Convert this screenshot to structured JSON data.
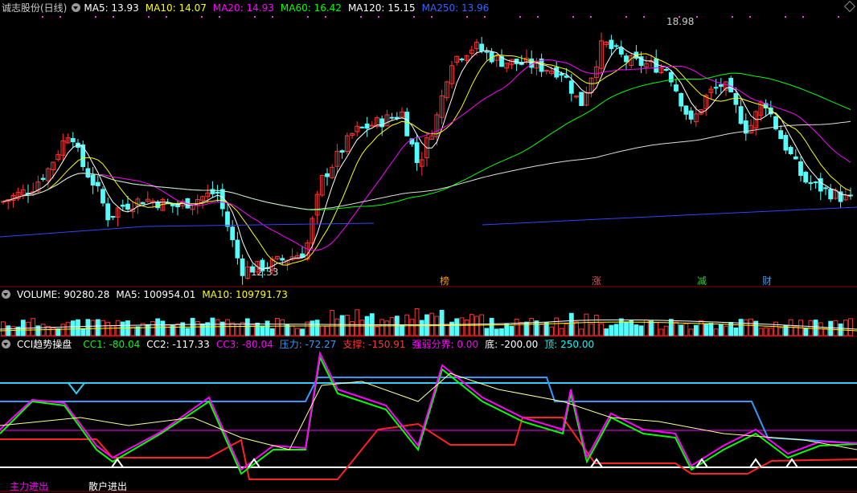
{
  "main": {
    "stock_name": "诚志股份(日线)",
    "ma": [
      {
        "label": "MA5: 13.93",
        "color": "#ffffff"
      },
      {
        "label": "MA10: 14.07",
        "color": "#ffff00"
      },
      {
        "label": "MA20: 14.93",
        "color": "#ff00ff"
      },
      {
        "label": "MA60: 16.42",
        "color": "#00ff00"
      },
      {
        "label": "MA120: 15.15",
        "color": "#ffffff"
      },
      {
        "label": "MA250: 13.96",
        "color": "#3366ff"
      }
    ],
    "high_label": "18.98",
    "low_label": "12.33",
    "markers": [
      {
        "text": "榜",
        "color": "#ff9900"
      },
      {
        "text": "涨",
        "color": "#ff4444"
      },
      {
        "text": "减",
        "color": "#33cc33"
      },
      {
        "text": "财",
        "color": "#3399ff"
      }
    ]
  },
  "volume": {
    "label": "VOLUME: 90280.28",
    "ma5": "MA5: 100954.01",
    "ma10": "MA10: 109791.73"
  },
  "cci": {
    "title": "CCI趋势操盘",
    "items": [
      {
        "label": "CC1: -80.04",
        "color": "#00ff00"
      },
      {
        "label": "CC2: -117.33",
        "color": "#ffffff"
      },
      {
        "label": "CC3: -80.04",
        "color": "#ff00ff"
      },
      {
        "label": "压力: -72.27",
        "color": "#3399ff"
      },
      {
        "label": "支撑: -150.91",
        "color": "#ff3333"
      },
      {
        "label": "强弱分界: 0.00",
        "color": "#ff00ff"
      },
      {
        "label": "底: -200.00",
        "color": "#ffffff"
      },
      {
        "label": "顶: 250.00",
        "color": "#00ffff"
      }
    ],
    "legend_main": "主力进出",
    "legend_retail": "散户进出"
  },
  "colors": {
    "up": "#ff3333",
    "down": "#54fcfc",
    "bg": "#000000"
  }
}
